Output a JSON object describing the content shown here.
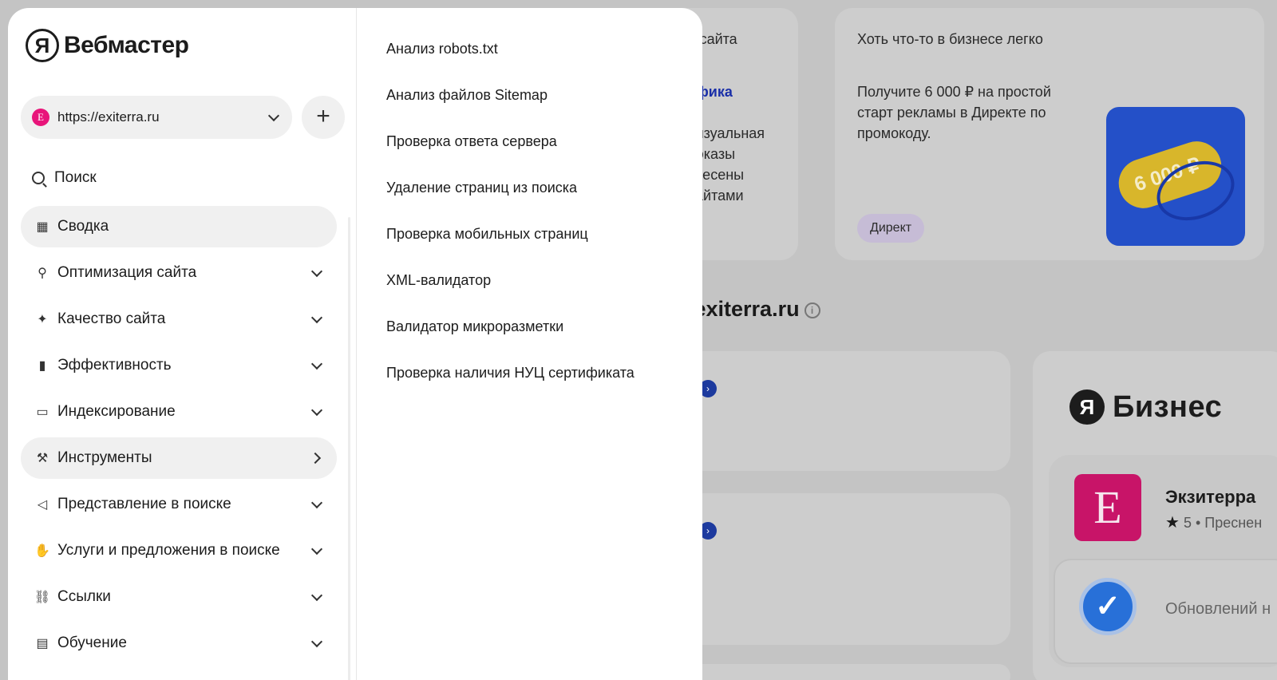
{
  "background": {
    "card1_fragments": [
      "в сайта",
      "афика",
      "визуальная",
      "показы",
      "тнесены",
      "сайтами"
    ],
    "promo_title": "Хоть что-то в бизнесе легко",
    "promo_text": "Получите 6 000 ₽ на простой старт рекламы в Директе по промокоду.",
    "promo_tag": "Директ",
    "promo_image_text": "6 000 ₽",
    "section_title": "/exiterra.ru",
    "arrow_glyph": "›",
    "info_glyph": "i",
    "business_logo_letter": "Я",
    "business_logo_word": "Бизнес",
    "org_logo_letter": "E",
    "org_name": "Экзитерра",
    "org_rating": "5",
    "org_location": "• Преснен",
    "updates_text": "Обновлений н",
    "check_glyph": "✓",
    "star_glyph": "★"
  },
  "header": {
    "logo_letter": "Я",
    "logo_word": "Вебмастер"
  },
  "site_selector": {
    "favicon_letter": "E",
    "url": "https://exiterra.ru",
    "add_label": "+"
  },
  "search": {
    "label": "Поиск",
    "icon": "search-icon"
  },
  "menu": [
    {
      "label": "Сводка",
      "icon": "grid-icon",
      "glyph": "▦",
      "active": true,
      "arrow": "none"
    },
    {
      "label": "Оптимизация сайта",
      "icon": "sitemap-icon",
      "glyph": "⚲",
      "arrow": "down"
    },
    {
      "label": "Качество сайта",
      "icon": "sparkle-icon",
      "glyph": "✦",
      "arrow": "down"
    },
    {
      "label": "Эффективность",
      "icon": "bars-icon",
      "glyph": "▮",
      "arrow": "down"
    },
    {
      "label": "Индексирование",
      "icon": "monitor-icon",
      "glyph": "▭",
      "arrow": "down"
    },
    {
      "label": "Инструменты",
      "icon": "wrench-icon",
      "glyph": "⚒",
      "active": true,
      "arrow": "right"
    },
    {
      "label": "Представление в поиске",
      "icon": "megaphone-icon",
      "glyph": "◁",
      "arrow": "down"
    },
    {
      "label": "Услуги и предложения в поиске",
      "icon": "hand-icon",
      "glyph": "✋",
      "arrow": "down"
    },
    {
      "label": "Ссылки",
      "icon": "link-icon",
      "glyph": "⛓",
      "arrow": "down"
    },
    {
      "label": "Обучение",
      "icon": "book-icon",
      "glyph": "▤",
      "arrow": "down"
    }
  ],
  "tools": [
    "Анализ robots.txt",
    "Анализ файлов Sitemap",
    "Проверка ответа сервера",
    "Удаление страниц из поиска",
    "Проверка мобильных страниц",
    "XML-валидатор",
    "Валидатор микроразметки",
    "Проверка наличия НУЦ сертификата"
  ]
}
